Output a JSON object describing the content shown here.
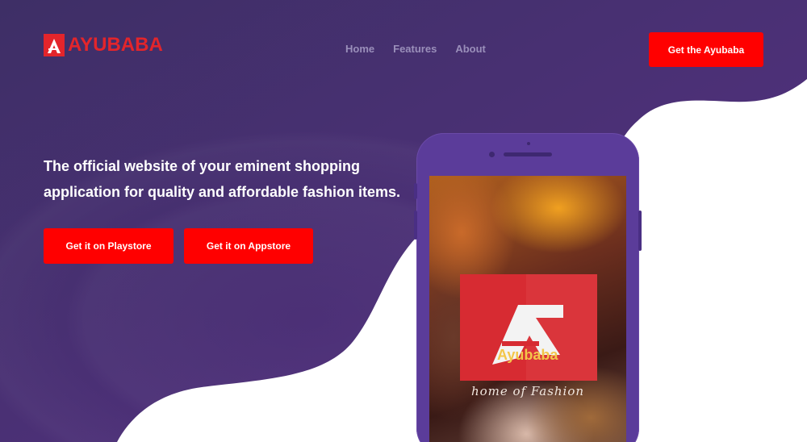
{
  "brand": {
    "name": "AYUBABA",
    "accent_color": "#ff0000",
    "logo_color": "#e3252b"
  },
  "nav": {
    "items": [
      "Home",
      "Features",
      "About"
    ]
  },
  "header": {
    "cta_label": "Get the Ayubaba"
  },
  "hero": {
    "headline": "The official website of your eminent shopping application for quality and affordable fashion items.",
    "playstore_label": "Get it on Playstore",
    "appstore_label": "Get it on Appstore"
  },
  "phone": {
    "app_name": "Ayubaba",
    "tagline": "home of Fashion"
  },
  "colors": {
    "hero_bg_start": "#3f3068",
    "hero_bg_end": "#5a2e82"
  }
}
